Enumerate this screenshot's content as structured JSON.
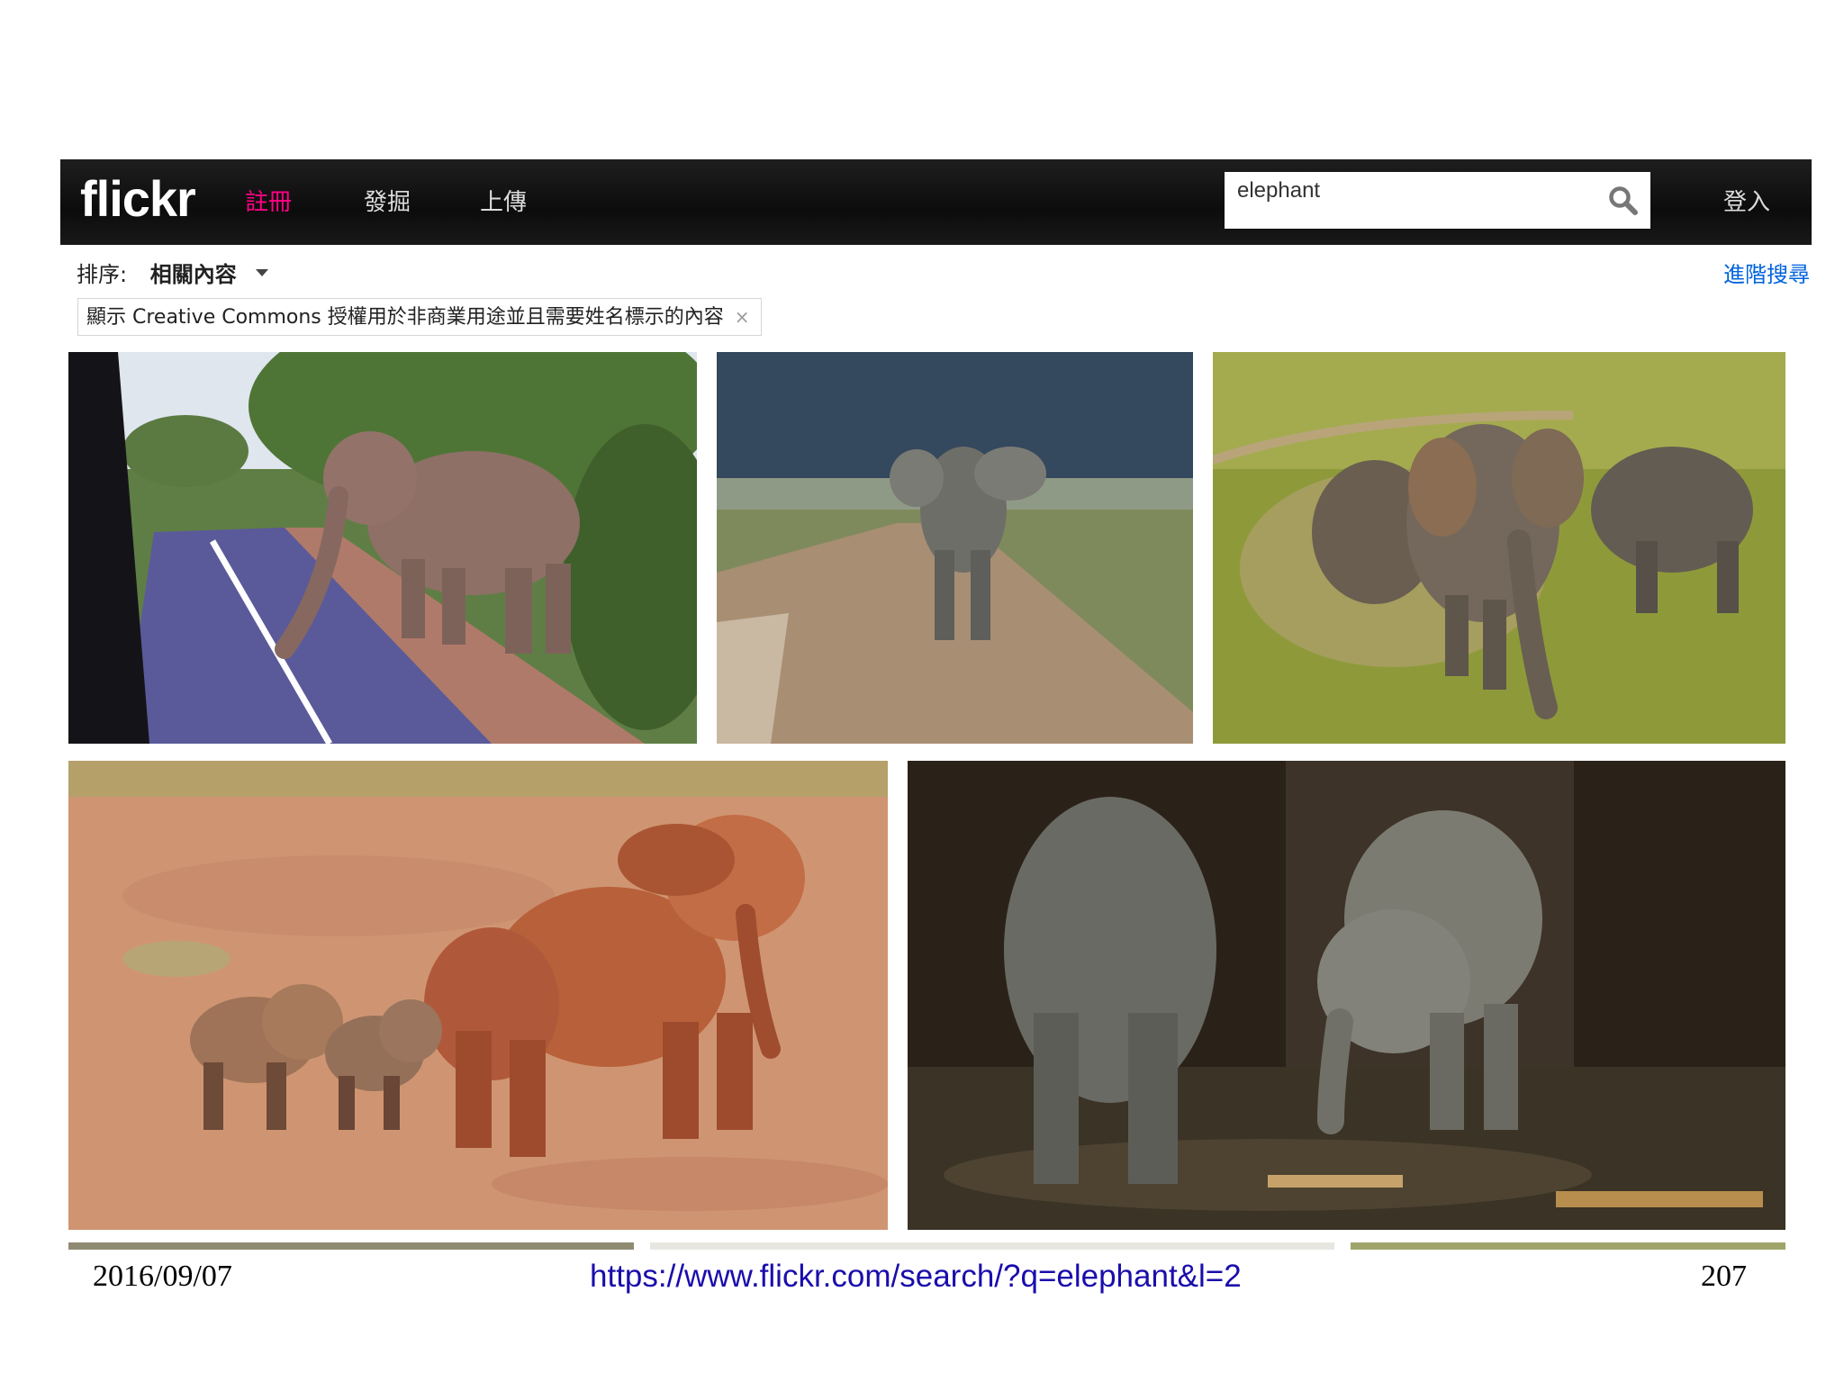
{
  "header": {
    "logo": "flickr",
    "nav": [
      {
        "label": "註冊"
      },
      {
        "label": "發掘"
      },
      {
        "label": "上傳"
      }
    ],
    "search": {
      "value": "elephant"
    },
    "login": "登入"
  },
  "toolbar": {
    "sort_label": "排序:",
    "sort_value": "相關內容",
    "advanced_search": "進階搜尋"
  },
  "filter": {
    "label": "顯示 Creative Commons 授權用於非商業用途並且需要姓名標示的內容",
    "close": "×"
  },
  "photos": [
    {
      "subject": "elephant crossing road"
    },
    {
      "subject": "elephant walking on dirt road"
    },
    {
      "subject": "elephants in dusty meadow"
    },
    {
      "subject": "red elephant with two calves"
    },
    {
      "subject": "two elephants in dark enclosure"
    }
  ],
  "footer": {
    "date": "2016/09/07",
    "url": "https://www.flickr.com/search/?q=elephant&l=2",
    "page": "207"
  },
  "colors": {
    "accent_pink": "#ff0084",
    "link_blue": "#0063dc",
    "navbar": "#111111"
  },
  "icons": [
    "search-icon",
    "chevron-down-icon",
    "close-icon"
  ]
}
